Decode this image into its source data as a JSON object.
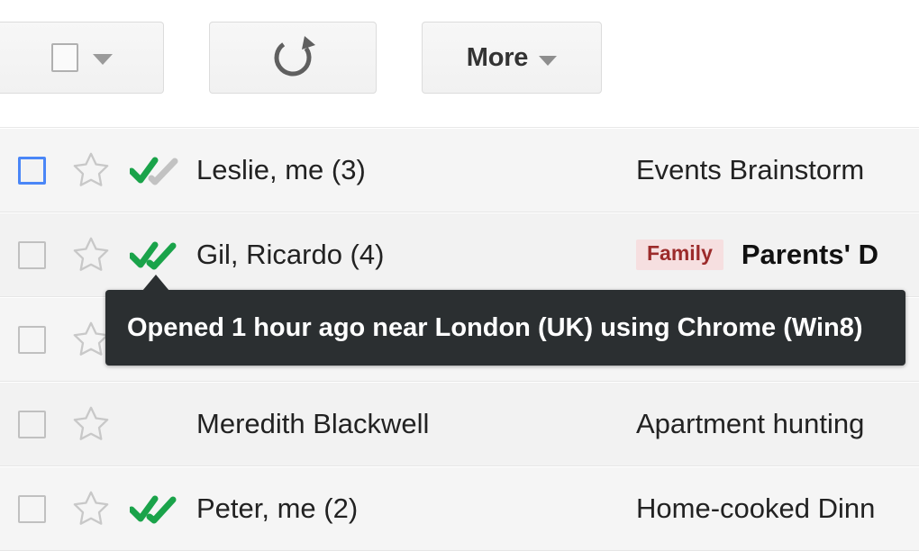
{
  "toolbar": {
    "select_all": {
      "label": "",
      "icon": "checkbox-icon",
      "caret_icon": "chevron-down-icon"
    },
    "refresh": {
      "label": "",
      "icon": "refresh-icon"
    },
    "more": {
      "label": "More",
      "caret_icon": "chevron-down-icon"
    }
  },
  "tooltip": {
    "text": "Opened 1 hour ago near London (UK) using Chrome (Win8)",
    "background": "#2b2f31",
    "color": "#ffffff"
  },
  "colors": {
    "read_check": "#1aa34a",
    "unread_check": "#bdbdbd",
    "star_outline": "#c8c8c8",
    "chip_bg": "#f6dfe0",
    "chip_text": "#9c2b2b",
    "checkbox_focus": "#4a86f7"
  },
  "mail_list": {
    "rows": [
      {
        "sender": "Leslie, me (3)",
        "subject": "Events Brainstorm",
        "label": "",
        "checkbox_focused": true,
        "marks": "half",
        "starred": false,
        "bold_subject": false
      },
      {
        "sender": "Gil, Ricardo (4)",
        "subject": "Parents' D",
        "label": "Family",
        "checkbox_focused": false,
        "marks": "full",
        "starred": false,
        "bold_subject": true
      },
      {
        "sender": "",
        "subject": "",
        "label": "",
        "checkbox_focused": false,
        "marks": "none",
        "starred": false,
        "bold_subject": false
      },
      {
        "sender": "Meredith Blackwell",
        "subject": "Apartment hunting",
        "label": "",
        "checkbox_focused": false,
        "marks": "none",
        "starred": false,
        "bold_subject": false
      },
      {
        "sender": "Peter, me (2)",
        "subject": "Home-cooked Dinn",
        "label": "",
        "checkbox_focused": false,
        "marks": "full",
        "starred": false,
        "bold_subject": false
      }
    ]
  }
}
